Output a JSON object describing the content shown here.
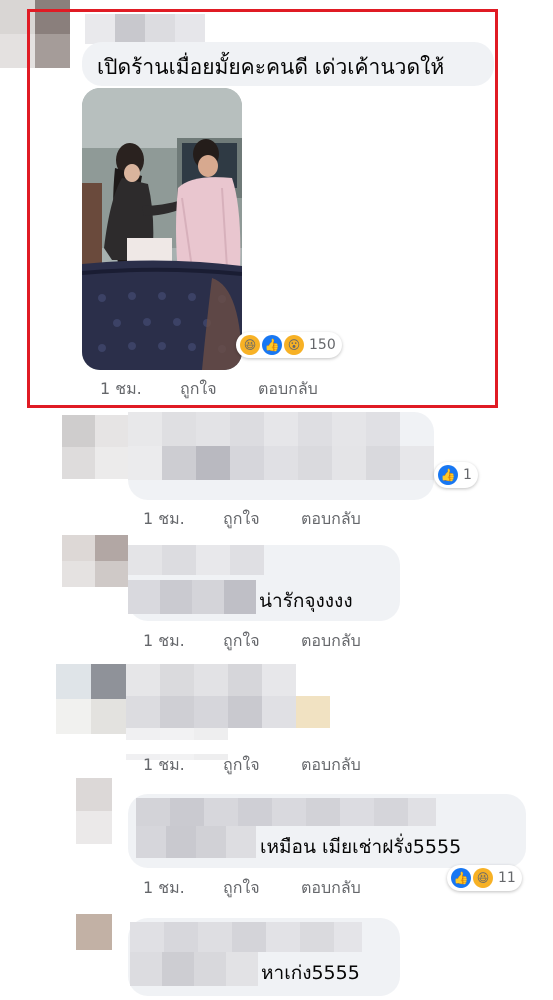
{
  "comments": [
    {
      "text": "เปิดร้านเมื่อยมั้ยคะคนดี เด่วเค้านวดให้",
      "time": "1 ชม.",
      "like": "ถูกใจ",
      "reply": "ตอบกลับ",
      "reaction_count": "150",
      "reactions": [
        "haha-icon",
        "like-icon",
        "wow-icon"
      ]
    },
    {
      "text": "",
      "time": "1 ชม.",
      "like": "ถูกใจ",
      "reply": "ตอบกลับ",
      "reaction_count": "1",
      "reactions": [
        "like-icon"
      ]
    },
    {
      "text": "น่ารักจุงงงง",
      "time": "1 ชม.",
      "like": "ถูกใจ",
      "reply": "ตอบกลับ"
    },
    {
      "text": "",
      "time": "1 ชม.",
      "like": "ถูกใจ",
      "reply": "ตอบกลับ"
    },
    {
      "text": "เหมือน เมียเช่าฝรั่ง5555",
      "time": "1 ชม.",
      "like": "ถูกใจ",
      "reply": "ตอบกลับ",
      "reaction_count": "11",
      "reactions": [
        "like-icon",
        "haha-icon"
      ]
    },
    {
      "text": "หาเก่ง5555"
    }
  ],
  "colors": {
    "highlight": "#e01b24",
    "bubble": "#f0f2f5",
    "meta": "#65676b",
    "like_blue": "#1877f2"
  }
}
